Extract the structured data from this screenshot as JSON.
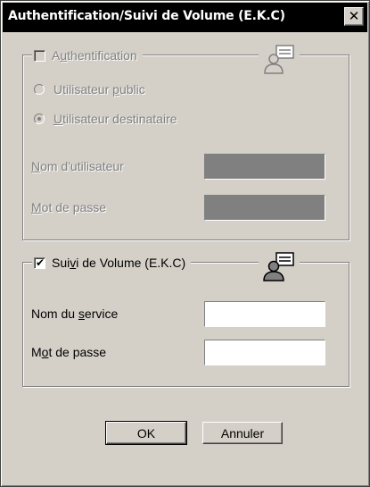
{
  "window": {
    "title": "Authentification/Suivi de Volume  (E.K.C)",
    "close_glyph": "✕"
  },
  "auth_group": {
    "checkbox_label_pre": "A",
    "checkbox_label_u": "u",
    "checkbox_label_post": "thentification",
    "checked": false,
    "enabled": false,
    "icon": "user-card-icon",
    "radio_public_pre": "Utilisateur ",
    "radio_public_u": "p",
    "radio_public_post": "ublic",
    "radio_recipient_pre": "",
    "radio_recipient_u": "U",
    "radio_recipient_post": "tilisateur destinataire",
    "selected_radio": "recipient",
    "username_label_pre": "",
    "username_label_u": "N",
    "username_label_post": "om d'utilisateur",
    "username_value": "",
    "password_label_pre": "",
    "password_label_u": "M",
    "password_label_post": "ot de passe",
    "password_value": ""
  },
  "volume_group": {
    "checkbox_label_pre": "Sui",
    "checkbox_label_u": "v",
    "checkbox_label_post": "i de Volume  (E.K.C)",
    "checked": true,
    "check_glyph": "✔",
    "enabled": true,
    "icon": "user-card-icon",
    "service_label_pre": "Nom du ",
    "service_label_u": "s",
    "service_label_post": "ervice",
    "service_value": "",
    "password_label_pre": "M",
    "password_label_u": "o",
    "password_label_post": "t de passe",
    "password_value": ""
  },
  "buttons": {
    "ok_label": "OK",
    "cancel_label": "Annuler"
  }
}
